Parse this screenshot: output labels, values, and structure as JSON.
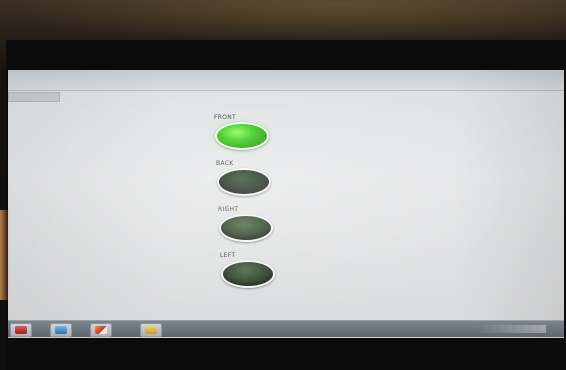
{
  "indicators": [
    {
      "label": "FRONT",
      "state": "on"
    },
    {
      "label": "BACK",
      "state": "off"
    },
    {
      "label": "RIGHT",
      "state": "off"
    },
    {
      "label": "LEFT",
      "state": "off"
    }
  ],
  "colors": {
    "led_on": "#3fd11d",
    "led_off": "#2c4128",
    "panel_background": "#e6e7e8"
  },
  "taskbar": {
    "buttons": [
      {
        "icon": "app-icon-red"
      },
      {
        "icon": "app-icon-blue"
      },
      {
        "icon": "app-icon-matlab"
      },
      {
        "icon": "app-icon-folder"
      }
    ]
  }
}
